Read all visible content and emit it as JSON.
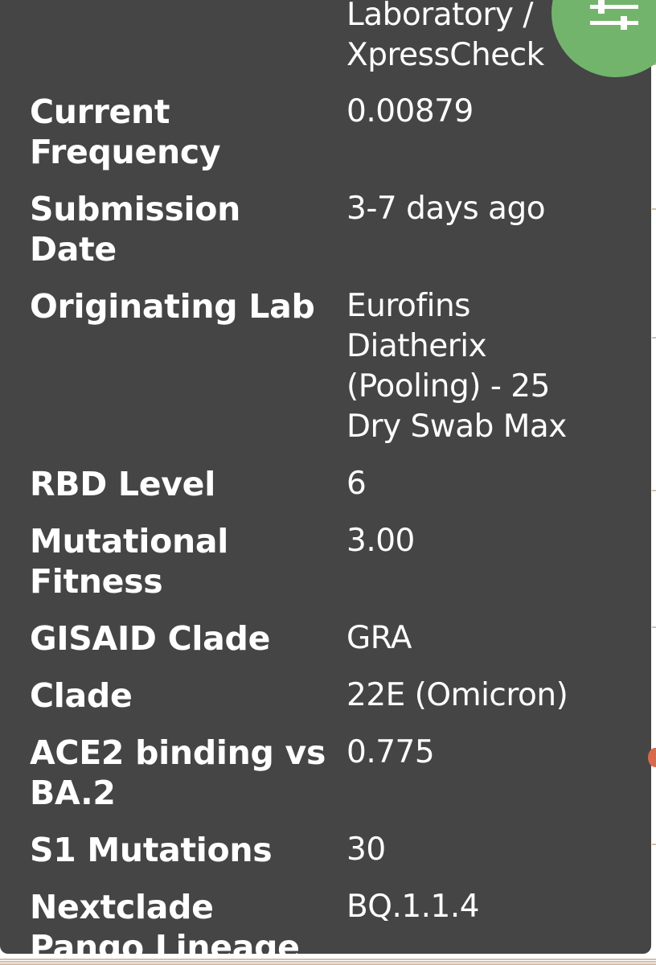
{
  "details": [
    {
      "key": "",
      "value": "Laboratory /\nXpressCheck"
    },
    {
      "key": "Current\nFrequency",
      "value": "0.00879"
    },
    {
      "key": "Submission\nDate",
      "value": "3-7 days ago"
    },
    {
      "key": "Originating Lab",
      "value": "Eurofins\nDiatherix\n(Pooling) - 25\nDry Swab Max"
    },
    {
      "key": "RBD Level",
      "value": "6"
    },
    {
      "key": "Mutational\nFitness",
      "value": "3.00"
    },
    {
      "key": "GISAID Clade",
      "value": "GRA"
    },
    {
      "key": "Clade",
      "value": "22E (Omicron)"
    },
    {
      "key": "ACE2 binding vs\nBA.2",
      "value": "0.775"
    },
    {
      "key": "S1 Mutations",
      "value": "30"
    },
    {
      "key": "Nextclade\nPango Lineage",
      "value": "BQ.1.1.4"
    }
  ],
  "controls": {
    "settings_icon": "sliders-icon"
  },
  "colors": {
    "panel_background": "#454545",
    "text": "#ffffff",
    "settings_button": "#73b46d",
    "tree_branch": "#c9a98a",
    "highlight_node": "#d9694c"
  }
}
